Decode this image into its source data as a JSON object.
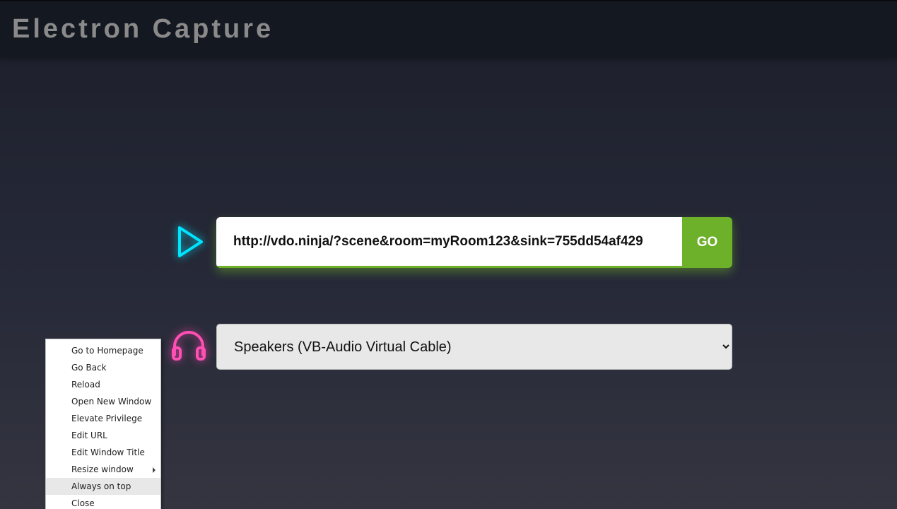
{
  "header": {
    "title": "Electron Capture"
  },
  "url_bar": {
    "value": "http://vdo.ninja/?scene&room=myRoom123&sink=755dd54af429",
    "go_label": "GO",
    "icon": "play-icon"
  },
  "audio_output": {
    "selected": "Speakers (VB-Audio Virtual Cable)",
    "icon": "headphones-icon"
  },
  "context_menu": {
    "items": [
      {
        "label": "Go to Homepage"
      },
      {
        "label": "Go Back"
      },
      {
        "label": "Reload"
      },
      {
        "label": "Open New Window"
      },
      {
        "label": "Elevate Privilege"
      },
      {
        "label": "Edit URL"
      },
      {
        "label": "Edit Window Title"
      },
      {
        "label": "Resize window",
        "has_submenu": true
      },
      {
        "label": "Always on top",
        "highlighted": true
      },
      {
        "label": "Close"
      }
    ]
  },
  "colors": {
    "accent_green": "#6db02a",
    "play_icon": "#00e5ff",
    "headphones_icon": "#ff4fb3",
    "title_text": "#8a8a8a"
  }
}
